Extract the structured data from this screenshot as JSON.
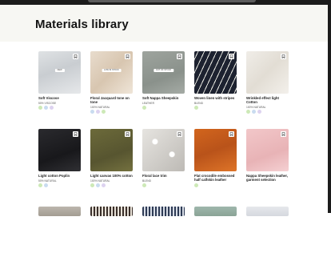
{
  "page": {
    "title": "Materials library"
  },
  "colors": {
    "header_bg": "#f7f7f3",
    "bezel": "#1c1c1c"
  },
  "materials": [
    {
      "name": "Soft Viscose",
      "composition": "50% VISCOSE",
      "tag": "NEW",
      "swatch": "linear-gradient(160deg,#dfe2e4 0%,#c9cdd1 45%,#e6e8ea 100%)",
      "icons": [
        "g",
        "b",
        "p"
      ]
    },
    {
      "name": "Floral Jacquard tone on tone",
      "composition": "100% NATURAL",
      "tag": "LOW IN STOCK",
      "swatch": "linear-gradient(135deg,#e8dccd 0%,#d8c6b0 50%,#efe5d8 100%)",
      "icons": [
        "b",
        "p",
        "g"
      ]
    },
    {
      "name": "Soft Nappa Sheepskin",
      "composition": "LEATHER",
      "tag": "OUT OF STOCK",
      "swatch": "linear-gradient(160deg,#9ea49e 0%,#8a918b 60%,#a5aba5 100%)",
      "icons": [
        "g"
      ]
    },
    {
      "name": "Woven linen with stripes",
      "composition": "BLEND",
      "tag": "",
      "swatch": "repeating-linear-gradient(115deg,#1d2230 0px,#1d2230 4px,#e9e9e2 4px,#e9e9e2 5px,#1d2230 5px,#1d2230 7px)",
      "icons": [
        "g"
      ]
    },
    {
      "name": "Wrinkled effect light Cotton",
      "composition": "100% NATURAL",
      "tag": "",
      "swatch": "linear-gradient(135deg,#f0ede8 0%,#e2ddd4 50%,#f3f0eb 100%)",
      "icons": [
        "g",
        "b",
        "p"
      ]
    },
    {
      "name": "Light cotton Poplin",
      "composition": "50% NATURAL",
      "tag": "",
      "swatch": "linear-gradient(160deg,#2a2a2e 0%,#18181b 60%,#303034 100%)",
      "icons": [
        "g",
        "b"
      ]
    },
    {
      "name": "Light canvas 100% cotton",
      "composition": "100% NATURAL",
      "tag": "",
      "swatch": "linear-gradient(160deg,#6c6a3a 0%,#575530 60%,#74713f 100%)",
      "icons": [
        "g",
        "b",
        "p"
      ]
    },
    {
      "name": "Floral lace trim",
      "composition": "BLEND",
      "tag": "",
      "swatch": "radial-gradient(circle at 30% 30%,#ffffff 0 3px,transparent 4px),radial-gradient(circle at 70% 60%,#ffffff 0 3px,transparent 4px),linear-gradient(135deg,#e6e4e0 0%,#bdbab5 100%)",
      "icons": [
        "g"
      ]
    },
    {
      "name": "Flat crocodile embossed half calfskin leather",
      "composition": "",
      "tag": "",
      "swatch": "linear-gradient(160deg,#d2651d 0%,#b9531a 50%,#de7428 100%)",
      "icons": [
        "g"
      ]
    },
    {
      "name": "Nappa Sheepskin leather, garment selection",
      "composition": "",
      "tag": "",
      "swatch": "linear-gradient(160deg,#f2c7c9 0%,#e8b3b6 60%,#f5d0d2 100%)",
      "icons": []
    },
    {
      "name": "",
      "composition": "",
      "tag": "",
      "swatch": "linear-gradient(180deg,#bcb6ad 0%,#a39c92 100%)",
      "icons": []
    },
    {
      "name": "",
      "composition": "",
      "tag": "",
      "swatch": "repeating-linear-gradient(90deg,#3a2f2a 0 2px,#e8e2d8 2px 4px)",
      "icons": []
    },
    {
      "name": "",
      "composition": "",
      "tag": "",
      "swatch": "repeating-linear-gradient(90deg,#2e3b55 0 2px,#d8dde6 2px 4px)",
      "icons": []
    },
    {
      "name": "",
      "composition": "",
      "tag": "",
      "swatch": "linear-gradient(180deg,#9fb7ac 0%,#8aa396 100%)",
      "icons": []
    },
    {
      "name": "",
      "composition": "",
      "tag": "",
      "swatch": "linear-gradient(180deg,#e6e8ec 0%,#d5d8de 100%)",
      "icons": []
    }
  ]
}
